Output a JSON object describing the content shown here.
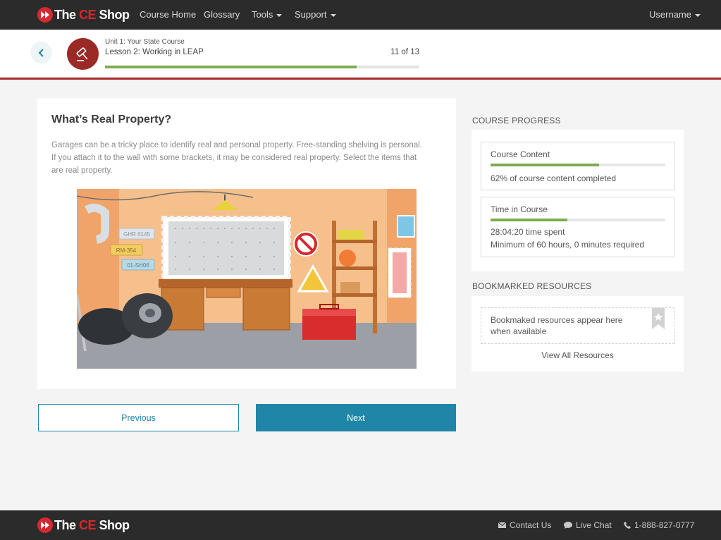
{
  "brand": {
    "part1": "The ",
    "part2": "CE",
    "part3": " Shop"
  },
  "nav": {
    "items": [
      "Course Home",
      "Glossary",
      "Tools",
      "Support"
    ],
    "user": "Username"
  },
  "lesson": {
    "unit": "Unit 1: Your State Course",
    "title": "Lesson 2: Working in LEAP",
    "count": "11 of 13",
    "progress_pct": 80
  },
  "content": {
    "title": "What’s Real Property?",
    "body": "Garages can be a tricky place to identify real and personal property. Free-standing shelving is personal. If you attach it to the wall with some brackets, it may be considered real property. Select the items that are real property.",
    "plates": [
      "GHR 0145",
      "RM-354",
      "01-SH06"
    ]
  },
  "buttons": {
    "previous": "Previous",
    "next": "Next"
  },
  "sidebar": {
    "progress_heading": "COURSE PROGRESS",
    "content_title": "Course Content",
    "content_pct": 62,
    "content_text": "62% of course content completed",
    "time_title": "Time in Course",
    "time_pct": 44,
    "time_spent": "28:04:20 time spent",
    "time_min": "Minimum of 60 hours, 0 minutes required",
    "bookmarks_heading": "BOOKMARKED RESOURCES",
    "bookmarks_text": "Bookmaked resources appear here when available",
    "view_all": "View All Resources"
  },
  "footer": {
    "contact": "Contact Us",
    "chat": "Live Chat",
    "phone": "1-888-827-0777"
  },
  "colors": {
    "accent": "#1f86a8",
    "brand_red": "#d7282f",
    "progress": "#7cac4f",
    "nav_bg": "#2b2b2b"
  }
}
